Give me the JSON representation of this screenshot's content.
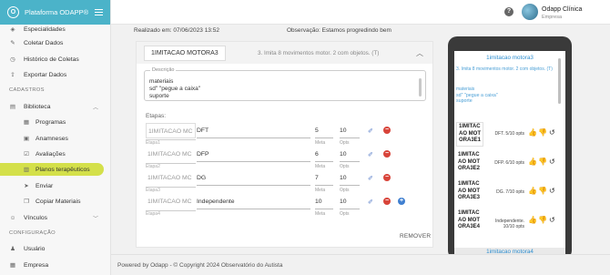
{
  "app": {
    "brand": "Plataforma ODAPP®",
    "logo_letter": "O"
  },
  "sidebar": {
    "top_items": [
      {
        "label": "Especialidades",
        "icon": "layers-icon"
      },
      {
        "label": "Coletar Dados",
        "icon": "pencil-icon"
      },
      {
        "label": "Histórico de Coletas",
        "icon": "history-icon"
      },
      {
        "label": "Exportar Dados",
        "icon": "export-icon"
      }
    ],
    "section_cadastros": "CADASTROS",
    "biblioteca": {
      "label": "Biblioteca",
      "icon": "book-icon"
    },
    "sub_items": [
      {
        "label": "Programas",
        "icon": "grid-icon"
      },
      {
        "label": "Anamneses",
        "icon": "clipboard-icon"
      },
      {
        "label": "Avaliações",
        "icon": "checklist-icon"
      },
      {
        "label": "Planos terapêuticos",
        "icon": "plan-icon",
        "active": true
      },
      {
        "label": "Enviar",
        "icon": "send-icon"
      },
      {
        "label": "Copiar Materiais",
        "icon": "copy-icon"
      }
    ],
    "vinculos": {
      "label": "Vínculos",
      "icon": "users-icon"
    },
    "section_configuracao": "CONFIGURAÇÃO",
    "config_items": [
      {
        "label": "Usuário",
        "icon": "user-icon"
      },
      {
        "label": "Empresa",
        "icon": "building-icon"
      }
    ]
  },
  "topbar": {
    "help": "?",
    "user_name": "Odapp Clínica",
    "user_role": "Empresa"
  },
  "meta": {
    "realizado": "Realizado em: 07/06/2023 13:52",
    "observacao": "Observação: Estamos progredindo bem"
  },
  "program": {
    "title": "1IMITACAO MOTORA3",
    "subtitle": "3. Imita 8 movimentos motor. 2 com objetos. (T)",
    "description_label": "Descrição",
    "description": "materiais\nsd\" \"pegue a caixa\"\nsuporte",
    "etapas_label": "Etapas:",
    "remover": "REMOVER",
    "meta_label": "Meta",
    "opts_label": "Opts",
    "etapas": [
      {
        "name": "1IMITACAO MC",
        "value": "DFT",
        "sublabel": "Etapa1",
        "meta": "5",
        "opts": "10",
        "highlight": true
      },
      {
        "name": "1IMITACAO MC",
        "value": "DFP",
        "sublabel": "Etapa2",
        "meta": "6",
        "opts": "10",
        "highlight": false
      },
      {
        "name": "1IMITACAO MC",
        "value": "DG",
        "sublabel": "Etapa3",
        "meta": "7",
        "opts": "10",
        "highlight": false
      },
      {
        "name": "1IMITACAO MC",
        "value": "Independente",
        "sublabel": "Etapa4",
        "meta": "10",
        "opts": "10",
        "highlight": false
      }
    ]
  },
  "phone": {
    "title": "1imitacao motora3",
    "info": "3. Imita 8 movimentos motor. 2 com objetos. (T)",
    "desc_label": "materiais",
    "desc": "sd\" \"pegue a caixa\"\nsuporte",
    "steps": [
      {
        "name": "1IMITAC AO MOT ORA3E1",
        "opts": "DFT. 5/10 opts",
        "highlight": true
      },
      {
        "name": "1IMITAC AO MOT ORA3E2",
        "opts": "DFP. 6/10 opts",
        "highlight": false
      },
      {
        "name": "1IMITAC AO MOT ORA3E3",
        "opts": "DG. 7/10 opts",
        "highlight": false
      },
      {
        "name": "1IMITAC AO MOT ORA3E4",
        "opts": "Independente. 10/10 opts",
        "highlight": false
      }
    ],
    "next_title": "1imitacao motora4"
  },
  "footer": {
    "text": "Powered by Odapp - © Copyright 2024 Observatório do Autista"
  },
  "colors": {
    "header": "#4bb3c9",
    "active": "#d4e04a",
    "remove": "#d8443a",
    "add": "#3f7fd0",
    "link": "#2f8fd0"
  }
}
